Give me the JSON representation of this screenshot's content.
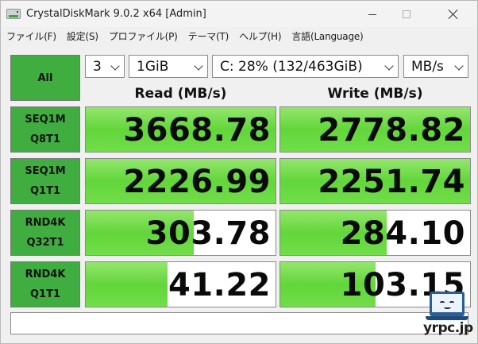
{
  "window": {
    "title": "CrystalDiskMark 9.0.2 x64 [Admin]"
  },
  "menu": [
    {
      "label": "ファイル(F)"
    },
    {
      "label": "設定(S)"
    },
    {
      "label": "プロファイル(P)"
    },
    {
      "label": "テーマ(T)"
    },
    {
      "label": "ヘルプ(H)"
    },
    {
      "label": "言語(Language)"
    }
  ],
  "controls": {
    "all_label": "All",
    "count": "3",
    "size": "1GiB",
    "drive": "C: 28% (132/463GiB)",
    "unit": "MB/s"
  },
  "headers": {
    "read": "Read (MB/s)",
    "write": "Write (MB/s)"
  },
  "tests": [
    {
      "line1": "SEQ1M",
      "line2": "Q8T1",
      "read": "3668.78",
      "write": "2778.82",
      "read_fill": 1.0,
      "write_fill": 1.0
    },
    {
      "line1": "SEQ1M",
      "line2": "Q1T1",
      "read": "2226.99",
      "write": "2251.74",
      "read_fill": 1.0,
      "write_fill": 1.0
    },
    {
      "line1": "RND4K",
      "line2": "Q32T1",
      "read": "303.78",
      "write": "284.10",
      "read_fill": 0.57,
      "write_fill": 0.56
    },
    {
      "line1": "RND4K",
      "line2": "Q1T1",
      "read": "41.22",
      "write": "103.15",
      "read_fill": 0.43,
      "write_fill": 0.5
    }
  ],
  "comment": "",
  "watermark": {
    "text": "yrpc.jp"
  },
  "colors": {
    "accent_green": "#3fad3f",
    "bar_green": "#62d63a"
  }
}
